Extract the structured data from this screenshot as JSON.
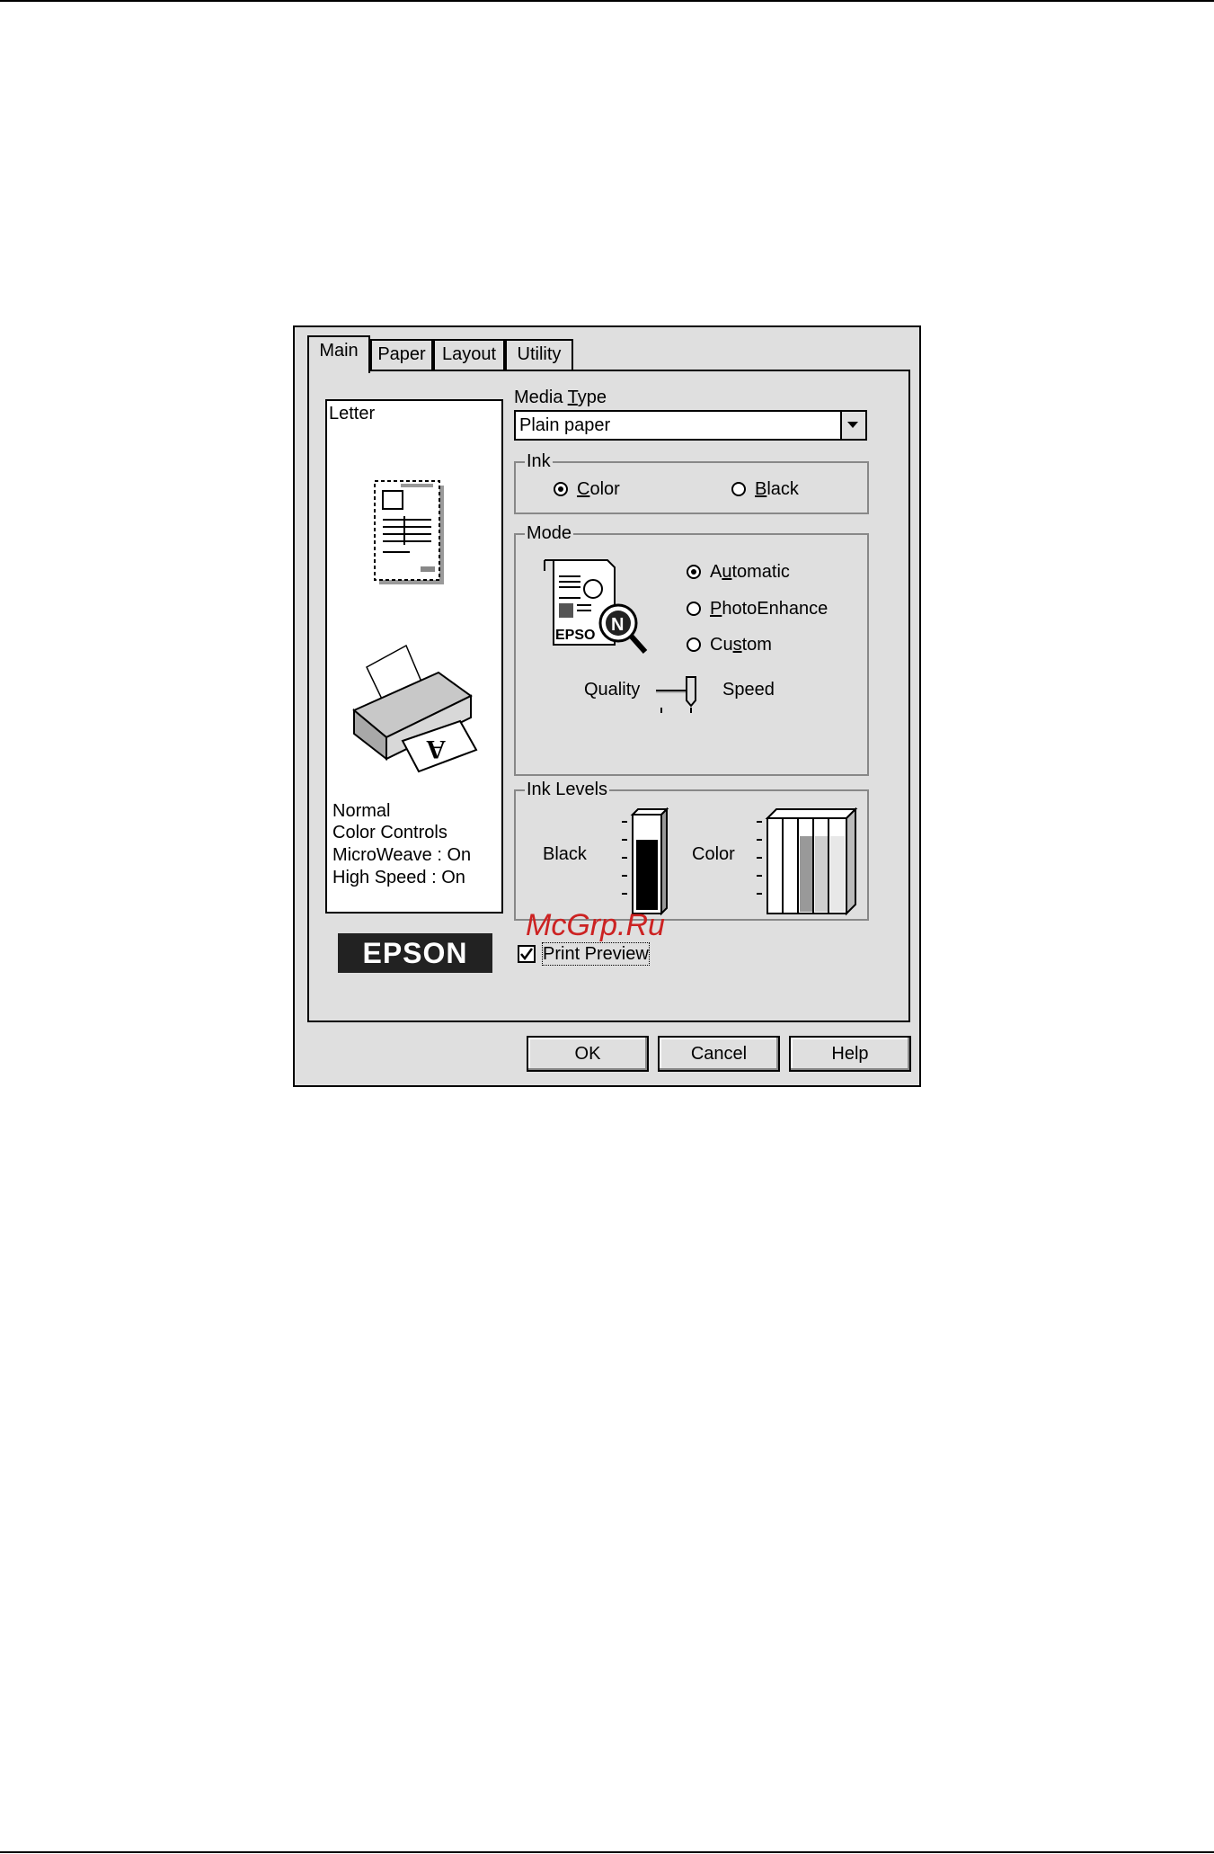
{
  "tabs": [
    {
      "label": "Main",
      "active": true
    },
    {
      "label": "Paper",
      "active": false
    },
    {
      "label": "Layout",
      "active": false
    },
    {
      "label": "Utility",
      "active": false
    }
  ],
  "preview": {
    "paper_size": "Letter",
    "status_lines": [
      "Normal",
      "Color Controls",
      "MicroWeave : On",
      "High Speed : On"
    ]
  },
  "brand_logo": "EPSON",
  "media_type": {
    "label_pre": "Media ",
    "label_key": "T",
    "label_post": "ype",
    "value": "Plain paper"
  },
  "ink": {
    "group_label": "Ink",
    "color": {
      "key": "C",
      "rest": "olor",
      "selected": true
    },
    "black": {
      "key": "B",
      "rest": "lack",
      "selected": false
    }
  },
  "mode": {
    "group_label": "Mode",
    "options": [
      {
        "pre": "A",
        "key": "u",
        "post": "tomatic",
        "selected": true
      },
      {
        "pre": "",
        "key": "P",
        "post": "hotoEnhance",
        "selected": false
      },
      {
        "pre": "Cu",
        "key": "s",
        "post": "tom",
        "selected": false
      }
    ],
    "slider_left": "Quality",
    "slider_right": "Speed",
    "icon_text": "EPSO",
    "icon_badge": "N"
  },
  "ink_levels": {
    "group_label": "Ink Levels",
    "black_label": "Black",
    "color_label": "Color"
  },
  "print_preview": {
    "label": "Print Preview",
    "checked": true
  },
  "buttons": {
    "ok": "OK",
    "cancel": "Cancel",
    "help": "Help"
  },
  "watermark": "McGrp.Ru"
}
